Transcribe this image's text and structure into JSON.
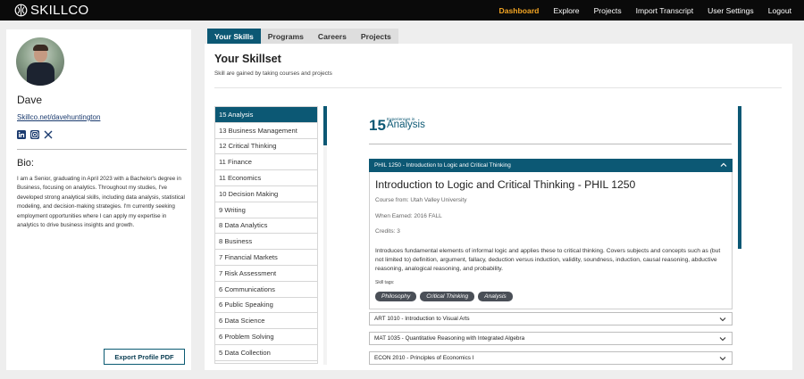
{
  "app": {
    "logo_text": "SKILLCO"
  },
  "nav": {
    "items": [
      {
        "label": "Dashboard",
        "active": true
      },
      {
        "label": "Explore",
        "active": false
      },
      {
        "label": "Projects",
        "active": false
      },
      {
        "label": "Import Transcript",
        "active": false
      },
      {
        "label": "User Settings",
        "active": false
      },
      {
        "label": "Logout",
        "active": false
      }
    ]
  },
  "profile": {
    "name": "Dave",
    "link": "Skillco.net/davehuntington",
    "social_icons": [
      "linkedin-icon",
      "instagram-icon",
      "x-icon"
    ],
    "bio_title": "Bio:",
    "bio": "I am a Senior, graduating in April 2023 with a Bachelor's degree in Business, focusing on analytics. Throughout my studies, I've developed strong analytical skills, including data analysis, statistical modeling, and decision-making strategies. I'm currently seeking employment opportunities where I can apply my expertise in analytics to drive business insights and growth.",
    "export_label": "Export Profile PDF"
  },
  "tabs": [
    {
      "label": "Your Skills",
      "active": true
    },
    {
      "label": "Programs",
      "active": false
    },
    {
      "label": "Careers",
      "active": false
    },
    {
      "label": "Projects",
      "active": false
    }
  ],
  "main": {
    "title": "Your Skillset",
    "subtitle": "Skill are gained by taking courses and projects"
  },
  "skills": [
    {
      "label": "15 Analysis",
      "active": true
    },
    {
      "label": "13 Business Management",
      "active": false
    },
    {
      "label": "12 Critical Thinking",
      "active": false
    },
    {
      "label": "11 Finance",
      "active": false
    },
    {
      "label": "11 Economics",
      "active": false
    },
    {
      "label": "10 Decision Making",
      "active": false
    },
    {
      "label": "9 Writing",
      "active": false
    },
    {
      "label": "8 Data Analytics",
      "active": false
    },
    {
      "label": "8 Business",
      "active": false
    },
    {
      "label": "7 Financial Markets",
      "active": false
    },
    {
      "label": "7 Risk Assessment",
      "active": false
    },
    {
      "label": "6 Communications",
      "active": false
    },
    {
      "label": "6 Public Speaking",
      "active": false
    },
    {
      "label": "6 Data Science",
      "active": false
    },
    {
      "label": "6 Problem Solving",
      "active": false
    },
    {
      "label": "5 Data Collection",
      "active": false
    }
  ],
  "detail": {
    "count": "15",
    "experiences_in": "Experiences in",
    "skill_name": "Analysis",
    "open_course": {
      "header": "PHIL 1250 - Introduction to Logic and Critical Thinking",
      "title": "Introduction to Logic and Critical Thinking - PHIL 1250",
      "course_from": "Course from:  Utah Valley University",
      "when_earned": "When Earned: 2016 FALL",
      "credits": "Credits: 3",
      "description": "Introduces fundamental elements of informal logic and applies these to critical thinking. Covers subjects and concepts such as (but not limited to) definition, argument, fallacy, deduction versus induction, validity, soundness, induction, causal reasoning, abductive reasoning, analogical reasoning, and probability.",
      "tags_label": "Skill tags:",
      "tags": [
        "Philosophy",
        "Critical Thinking",
        "Analysis"
      ]
    },
    "courses": [
      {
        "label": "ART 1010 - Introduction to Visual Arts"
      },
      {
        "label": "MAT 1035 - Quantitative Reasoning with Integrated Algebra"
      },
      {
        "label": "ECON 2010 - Principles of Economics I"
      }
    ]
  }
}
